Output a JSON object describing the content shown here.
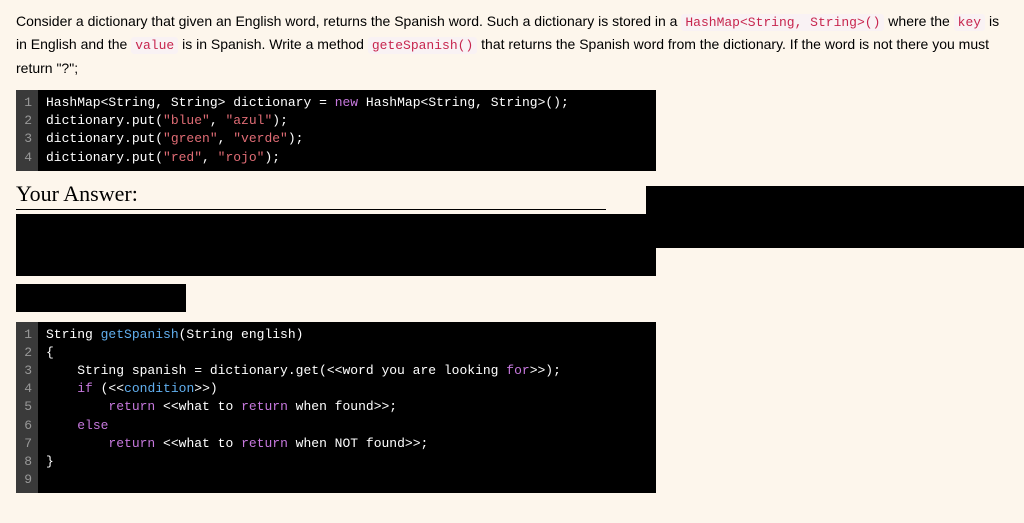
{
  "question": {
    "parts": [
      {
        "text": "Consider a dictionary that given an English word, returns the Spanish word. Such a dictionary is stored in a "
      },
      {
        "code": "HashMap<String, String>()"
      },
      {
        "text": " where the "
      },
      {
        "code": "key"
      },
      {
        "text": " is in English and the "
      },
      {
        "code": "value"
      },
      {
        "text": " is in Spanish. Write a method "
      },
      {
        "code": "geteSpanish()"
      },
      {
        "text": " that returns the Spanish word from the dictionary. If the word is not there you must return \"?\";"
      }
    ]
  },
  "codeBlock1": {
    "lines": [
      {
        "num": "1",
        "tokens": [
          {
            "t": "HashMap",
            "c": ""
          },
          {
            "t": "<",
            "c": ""
          },
          {
            "t": "String",
            "c": ""
          },
          {
            "t": ", ",
            "c": ""
          },
          {
            "t": "String",
            "c": ""
          },
          {
            "t": "> dictionary = ",
            "c": ""
          },
          {
            "t": "new",
            "c": "k-new"
          },
          {
            "t": " HashMap",
            "c": ""
          },
          {
            "t": "<",
            "c": ""
          },
          {
            "t": "String",
            "c": ""
          },
          {
            "t": ", ",
            "c": ""
          },
          {
            "t": "String",
            "c": ""
          },
          {
            "t": ">();",
            "c": ""
          }
        ]
      },
      {
        "num": "2",
        "tokens": [
          {
            "t": "dictionary.put(",
            "c": ""
          },
          {
            "t": "\"blue\"",
            "c": "k-string"
          },
          {
            "t": ", ",
            "c": ""
          },
          {
            "t": "\"azul\"",
            "c": "k-string"
          },
          {
            "t": ");",
            "c": ""
          }
        ]
      },
      {
        "num": "3",
        "tokens": [
          {
            "t": "dictionary.put(",
            "c": ""
          },
          {
            "t": "\"green\"",
            "c": "k-string"
          },
          {
            "t": ", ",
            "c": ""
          },
          {
            "t": "\"verde\"",
            "c": "k-string"
          },
          {
            "t": ");",
            "c": ""
          }
        ]
      },
      {
        "num": "4",
        "tokens": [
          {
            "t": "dictionary.put(",
            "c": ""
          },
          {
            "t": "\"red\"",
            "c": "k-string"
          },
          {
            "t": ", ",
            "c": ""
          },
          {
            "t": "\"rojo\"",
            "c": "k-string"
          },
          {
            "t": ");",
            "c": ""
          }
        ]
      }
    ]
  },
  "answerHeader": "Your Answer:",
  "codeBlock2": {
    "lines": [
      {
        "num": "1",
        "tokens": [
          {
            "t": "String ",
            "c": ""
          },
          {
            "t": "getSpanish",
            "c": "k-method"
          },
          {
            "t": "(String english)",
            "c": ""
          }
        ]
      },
      {
        "num": "2",
        "tokens": [
          {
            "t": "{",
            "c": ""
          }
        ]
      },
      {
        "num": "3",
        "tokens": [
          {
            "t": "    String spanish = dictionary.get(<<",
            "c": ""
          },
          {
            "t": "word you are looking ",
            "c": ""
          },
          {
            "t": "for",
            "c": "k-new"
          },
          {
            "t": ">>);",
            "c": ""
          }
        ]
      },
      {
        "num": "4",
        "tokens": [
          {
            "t": "    ",
            "c": ""
          },
          {
            "t": "if",
            "c": "k-new"
          },
          {
            "t": " (<<",
            "c": ""
          },
          {
            "t": "condition",
            "c": "k-method"
          },
          {
            "t": ">>)",
            "c": ""
          }
        ]
      },
      {
        "num": "5",
        "tokens": [
          {
            "t": "        ",
            "c": ""
          },
          {
            "t": "return",
            "c": "k-new"
          },
          {
            "t": " <<what to ",
            "c": ""
          },
          {
            "t": "return",
            "c": "k-new"
          },
          {
            "t": " when found>>;",
            "c": ""
          }
        ]
      },
      {
        "num": "6",
        "tokens": [
          {
            "t": "    ",
            "c": ""
          },
          {
            "t": "else",
            "c": "k-new"
          }
        ]
      },
      {
        "num": "7",
        "tokens": [
          {
            "t": "        ",
            "c": ""
          },
          {
            "t": "return",
            "c": "k-new"
          },
          {
            "t": " <<what to ",
            "c": ""
          },
          {
            "t": "return",
            "c": "k-new"
          },
          {
            "t": " when NOT found>>;",
            "c": ""
          }
        ]
      },
      {
        "num": "8",
        "tokens": [
          {
            "t": "}",
            "c": ""
          }
        ]
      },
      {
        "num": "9",
        "tokens": [
          {
            "t": "",
            "c": ""
          }
        ]
      }
    ]
  }
}
